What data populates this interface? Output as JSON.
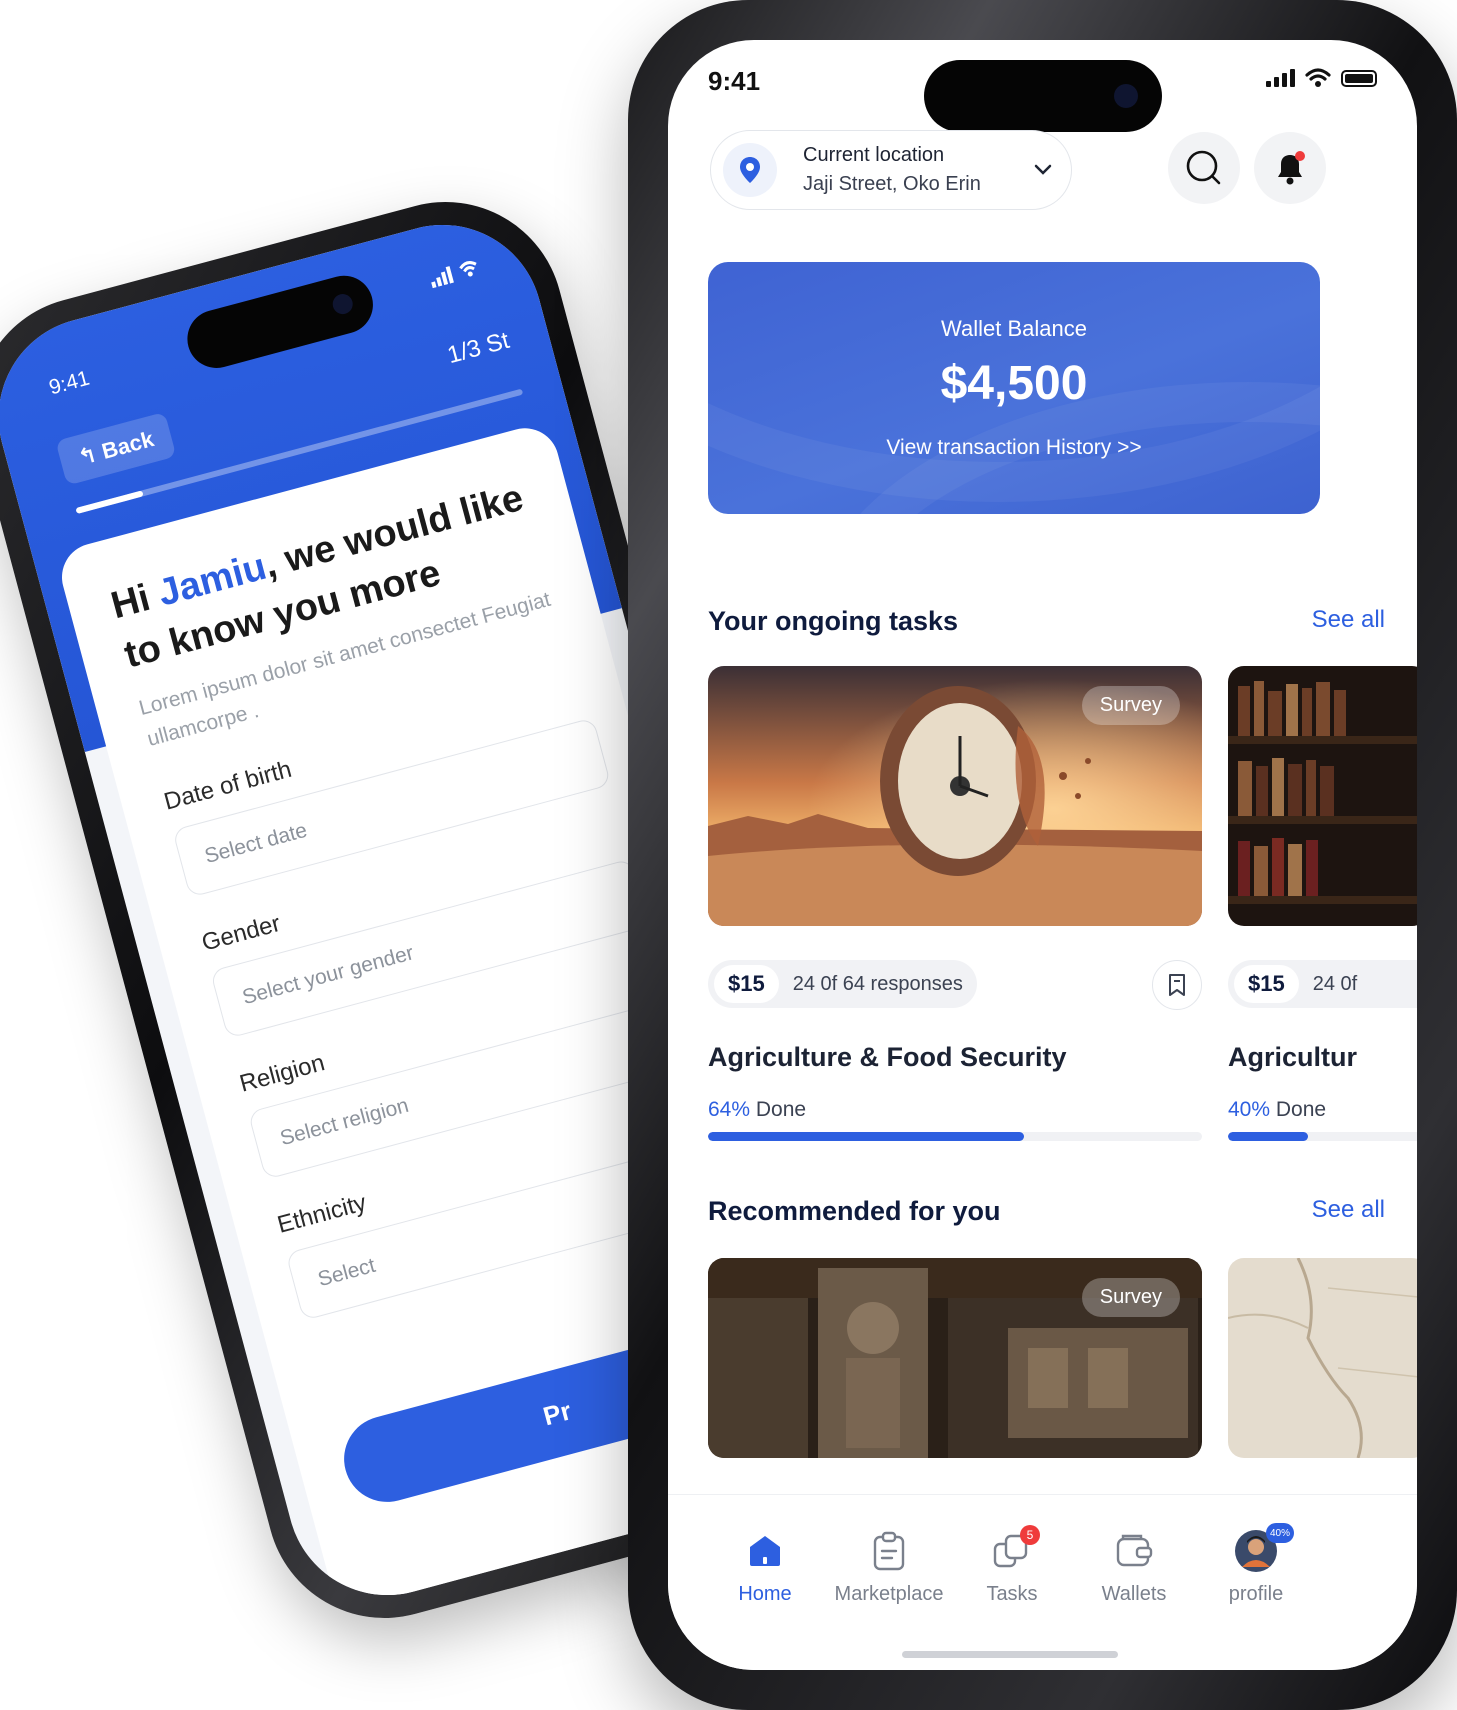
{
  "back_phone": {
    "status_time": "9:41",
    "back_label": "Back",
    "step": "1/3 St",
    "step_progress": 0.15,
    "greeting_prefix": "Hi ",
    "greeting_name": "Jamiu",
    "greeting_suffix": ", we would like to know you more",
    "lorem": "Lorem ipsum dolor sit amet consectet Feugiat ullamcorpe .",
    "fields": [
      {
        "label": "Date of birth",
        "placeholder": "Select date"
      },
      {
        "label": "Gender",
        "placeholder": "Select your gender"
      },
      {
        "label": "Religion",
        "placeholder": "Select religion"
      },
      {
        "label": "Ethnicity",
        "placeholder": "Select"
      }
    ],
    "proceed_label": "Pr"
  },
  "front_phone": {
    "status_time": "9:41",
    "location": {
      "title": "Current location",
      "address": "Jaji Street, Oko Erin"
    },
    "icons": {
      "search": "search-icon",
      "notification": "bell-icon",
      "location": "location-pin-icon"
    },
    "wallet": {
      "label": "Wallet Balance",
      "amount": "$4,500",
      "link": "View transaction History >>"
    },
    "ongoing": {
      "title": "Your ongoing tasks",
      "see_all": "See all",
      "cards": [
        {
          "tag": "Survey",
          "price": "$15",
          "responses": "24 0f 64 responses",
          "title": "Agriculture & Food Security",
          "percent_label": "64%",
          "done_label": " Done",
          "progress": 0.64
        },
        {
          "tag": "",
          "price": "$15",
          "responses": "24 0f",
          "title": "Agricultur",
          "percent_label": "40%",
          "done_label": " Done",
          "progress": 0.4
        }
      ]
    },
    "recommended": {
      "title": "Recommended for you",
      "see_all": "See all",
      "cards": [
        {
          "tag": "Survey"
        },
        {
          "tag": ""
        }
      ]
    },
    "tabs": [
      {
        "label": "Home",
        "icon": "home-icon",
        "active": true
      },
      {
        "label": "Marketplace",
        "icon": "clipboard-icon",
        "active": false
      },
      {
        "label": "Tasks",
        "icon": "tasks-icon",
        "active": false,
        "badge": "5"
      },
      {
        "label": "Wallets",
        "icon": "wallet-icon",
        "active": false
      },
      {
        "label": "profile",
        "icon": "avatar-icon",
        "active": false,
        "badge": "40%"
      }
    ],
    "colors": {
      "accent": "#2d5fe0",
      "wallet": "#4468d6",
      "badge": "#ef3b3b"
    }
  }
}
